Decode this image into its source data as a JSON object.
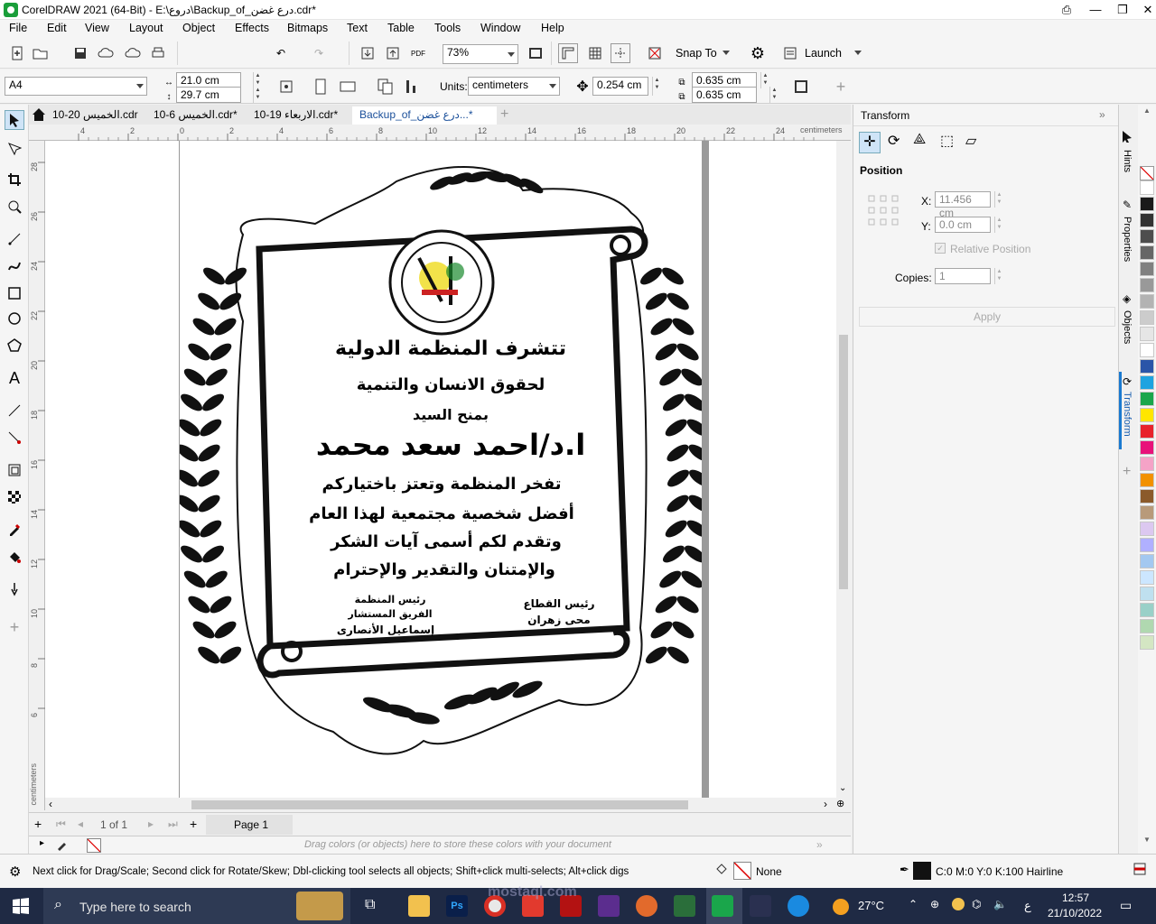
{
  "window": {
    "title": "CorelDRAW 2021 (64-Bit) - E:\\دروع\\Backup_of_درع غضن.cdr*"
  },
  "menu": [
    "File",
    "Edit",
    "View",
    "Layout",
    "Object",
    "Effects",
    "Bitmaps",
    "Text",
    "Table",
    "Tools",
    "Window",
    "Help"
  ],
  "stdbar": {
    "zoom": "73%",
    "snap_label": "Snap To",
    "launch_label": "Launch"
  },
  "propbar": {
    "page_size": "A4",
    "width": "21.0 cm",
    "height": "29.7 cm",
    "units_label": "Units:",
    "units": "centimeters",
    "nudge": "0.254 cm",
    "dup_x": "0.635 cm",
    "dup_y": "0.635 cm"
  },
  "tabs": [
    "الخميس 20-10.cdr",
    "الخميس 6-10.cdr*",
    "الاربعاء 19-10.cdr*",
    "Backup_of_درع غضن...*"
  ],
  "rulers": {
    "h_unit": "centimeters",
    "v_unit": "centimeters",
    "h_ticks": [
      "4",
      "2",
      "0",
      "2",
      "4",
      "6",
      "8",
      "10",
      "12",
      "14",
      "16",
      "18",
      "20",
      "22",
      "24"
    ],
    "v_ticks": [
      "28",
      "26",
      "24",
      "22",
      "20",
      "18",
      "16",
      "14",
      "12",
      "10",
      "8",
      "6"
    ]
  },
  "document": {
    "title_line": "تتشرف المنظمة الدولية",
    "line2": "لحقوق الانسان والتنمية",
    "line3": "بمنح السيد",
    "name": "ا.د/احمد سعد محمد",
    "body1": "تفخر المنظمة وتعتز باختياركم",
    "body2": "أفضل شخصية مجتمعية لهذا العام",
    "body3": "وتقدم لكم أسمى آيات الشكر",
    "body4": "والإمتنان والتقدير والإحترام",
    "sig_left_1": "رئيس المنظمة",
    "sig_left_2": "الفريق المستشار",
    "sig_left_3": "إسماعيل الأنصارى",
    "sig_right_1": "رئيس القطاع",
    "sig_right_2": "محى زهران"
  },
  "pagenav": {
    "counter": "1 of 1",
    "page_tab": "Page 1"
  },
  "colorbar": {
    "hint": "Drag colors (or objects) here to store these colors with your document"
  },
  "docker": {
    "title": "Transform",
    "section": "Position",
    "x_label": "X:",
    "x_value": "11.456 cm",
    "y_label": "Y:",
    "y_value": "0.0 cm",
    "relative": "Relative Position",
    "copies_label": "Copies:",
    "copies": "1",
    "apply": "Apply"
  },
  "docker_tabs": [
    "Hints",
    "Properties",
    "Objects",
    "Transform"
  ],
  "palette": [
    "#ffffff",
    "#1a1a1a",
    "#333333",
    "#4d4d4d",
    "#666666",
    "#808080",
    "#999999",
    "#b3b3b3",
    "#cccccc",
    "#e6e6e6",
    "#ffffff",
    "#2b55a8",
    "#1fa3e0",
    "#1aa64b",
    "#ffe600",
    "#e8222b",
    "#e8127a",
    "#f5a3c7",
    "#f29100",
    "#8b5a2b",
    "#b89a7a",
    "#dcc8f0",
    "#b0b0ff",
    "#a3c8f0",
    "#cce6ff",
    "#bfe0ef",
    "#9ad0c8",
    "#b0d8b0",
    "#d4e6c3"
  ],
  "status": {
    "message": "Next click for Drag/Scale; Second click for Rotate/Skew; Dbl-clicking tool selects all objects; Shift+click multi-selects; Alt+click digs",
    "fill": "None",
    "outline": "C:0 M:0 Y:0 K:100  Hairline"
  },
  "taskbar": {
    "search": "Type here to search",
    "weather": "27°C",
    "time": "12:57",
    "date": "21/10/2022",
    "lang": "ع"
  },
  "watermark": "mostaql.com"
}
